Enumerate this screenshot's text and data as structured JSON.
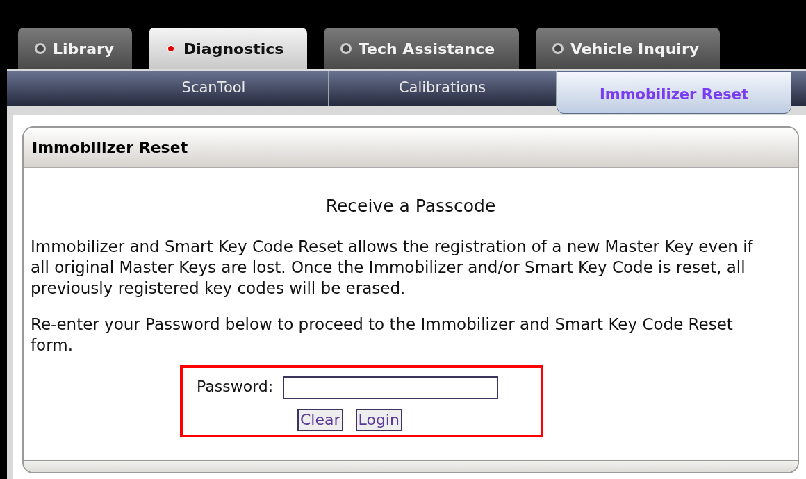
{
  "tabs": [
    {
      "label": "Library",
      "selected": false
    },
    {
      "label": "Diagnostics",
      "selected": true
    },
    {
      "label": "Tech Assistance",
      "selected": false
    },
    {
      "label": "Vehicle Inquiry",
      "selected": false
    }
  ],
  "subtabs": [
    {
      "label": "ScanTool",
      "selected": false
    },
    {
      "label": "Calibrations",
      "selected": false
    },
    {
      "label": "Immobilizer Reset",
      "selected": true
    }
  ],
  "panel": {
    "title": "Immobilizer Reset",
    "heading": "Receive a Passcode",
    "paragraphs": [
      "Immobilizer and Smart Key Code Reset allows the registration of a new Master Key even if all original Master Keys are lost. Once the Immobilizer and/or Smart Key Code is reset, all previously registered key codes will be erased.",
      "Re-enter your Password below to proceed to the Immobilizer and Smart Key Code Reset form."
    ],
    "form": {
      "highlighted": true,
      "password_label": "Password:",
      "buttons": [
        "Clear",
        "Login"
      ]
    }
  }
}
